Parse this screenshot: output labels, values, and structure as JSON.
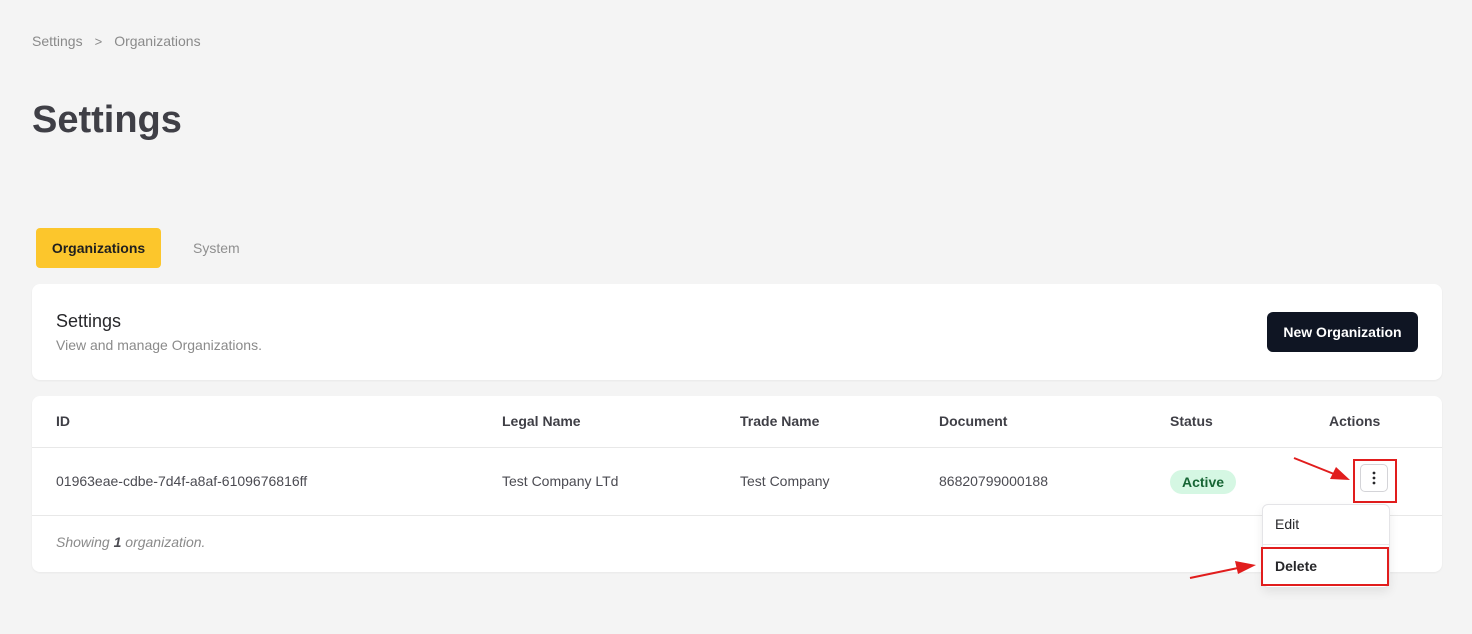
{
  "breadcrumb": {
    "items": [
      "Settings",
      "Organizations"
    ],
    "separator": ">"
  },
  "page_title": "Settings",
  "tabs": [
    {
      "label": "Organizations",
      "active": true
    },
    {
      "label": "System",
      "active": false
    }
  ],
  "header_card": {
    "title": "Settings",
    "subtitle": "View and manage Organizations.",
    "new_button_label": "New Organization"
  },
  "table": {
    "columns": [
      "ID",
      "Legal Name",
      "Trade Name",
      "Document",
      "Status",
      "Actions"
    ],
    "rows": [
      {
        "id": "01963eae-cdbe-7d4f-a8af-6109676816ff",
        "legal_name": "Test Company LTd",
        "trade_name": "Test Company",
        "document": "86820799000188",
        "status": "Active"
      }
    ],
    "footer": {
      "prefix": "Showing ",
      "count": "1",
      "suffix": " organization."
    }
  },
  "actions_menu": {
    "items": [
      "Edit",
      "Delete"
    ]
  },
  "colors": {
    "accent_tab": "#fcc62c",
    "primary_button": "#0f1523",
    "status_active_bg": "#d5f7e3",
    "status_active_text": "#166534",
    "annotation_red": "#e11d1d"
  },
  "icons": {
    "actions": "vertical-ellipsis-icon",
    "breadcrumb_separator": "chevron-right-icon"
  }
}
